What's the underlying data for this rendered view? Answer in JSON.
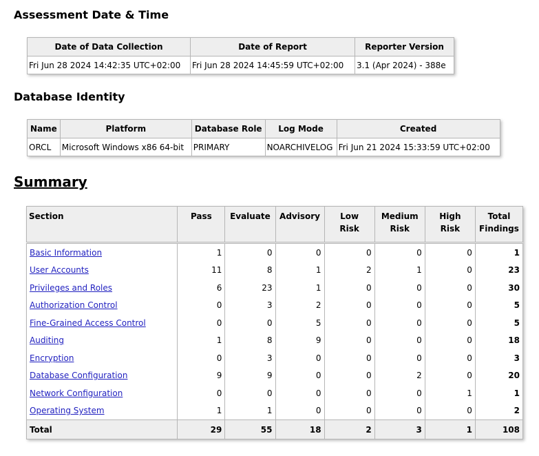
{
  "sections": {
    "assessment_title": "Assessment Date & Time",
    "identity_title": "Database Identity",
    "summary_title": "Summary"
  },
  "assessment": {
    "headers": [
      "Date of Data Collection",
      "Date of Report",
      "Reporter Version"
    ],
    "row": [
      "Fri Jun 28 2024 14:42:35 UTC+02:00",
      "Fri Jun 28 2024 14:45:59 UTC+02:00",
      "3.1 (Apr 2024) - 388e"
    ]
  },
  "identity": {
    "headers": [
      "Name",
      "Platform",
      "Database Role",
      "Log Mode",
      "Created"
    ],
    "row": [
      "ORCL",
      "Microsoft Windows x86 64-bit",
      "PRIMARY",
      "NOARCHIVELOG",
      "Fri Jun 21 2024 15:33:59 UTC+02:00"
    ]
  },
  "summary": {
    "headers": {
      "section": "Section",
      "pass": "Pass",
      "evaluate": "Evaluate",
      "advisory": "Advisory",
      "low1": "Low",
      "low2": "Risk",
      "med1": "Medium",
      "med2": "Risk",
      "high1": "High",
      "high2": "Risk",
      "total1": "Total",
      "total2": "Findings"
    },
    "rows": [
      {
        "section": "Basic Information",
        "pass": "1",
        "evaluate": "0",
        "advisory": "0",
        "low": "0",
        "medium": "0",
        "high": "0",
        "total": "1"
      },
      {
        "section": "User Accounts",
        "pass": "11",
        "evaluate": "8",
        "advisory": "1",
        "low": "2",
        "medium": "1",
        "high": "0",
        "total": "23"
      },
      {
        "section": "Privileges and Roles",
        "pass": "6",
        "evaluate": "23",
        "advisory": "1",
        "low": "0",
        "medium": "0",
        "high": "0",
        "total": "30"
      },
      {
        "section": "Authorization Control",
        "pass": "0",
        "evaluate": "3",
        "advisory": "2",
        "low": "0",
        "medium": "0",
        "high": "0",
        "total": "5"
      },
      {
        "section": "Fine-Grained Access Control",
        "pass": "0",
        "evaluate": "0",
        "advisory": "5",
        "low": "0",
        "medium": "0",
        "high": "0",
        "total": "5"
      },
      {
        "section": "Auditing",
        "pass": "1",
        "evaluate": "8",
        "advisory": "9",
        "low": "0",
        "medium": "0",
        "high": "0",
        "total": "18"
      },
      {
        "section": "Encryption",
        "pass": "0",
        "evaluate": "3",
        "advisory": "0",
        "low": "0",
        "medium": "0",
        "high": "0",
        "total": "3"
      },
      {
        "section": "Database Configuration",
        "pass": "9",
        "evaluate": "9",
        "advisory": "0",
        "low": "0",
        "medium": "2",
        "high": "0",
        "total": "20"
      },
      {
        "section": "Network Configuration",
        "pass": "0",
        "evaluate": "0",
        "advisory": "0",
        "low": "0",
        "medium": "0",
        "high": "1",
        "total": "1"
      },
      {
        "section": "Operating System",
        "pass": "1",
        "evaluate": "1",
        "advisory": "0",
        "low": "0",
        "medium": "0",
        "high": "0",
        "total": "2"
      }
    ],
    "total": {
      "label": "Total",
      "pass": "29",
      "evaluate": "55",
      "advisory": "18",
      "low": "2",
      "medium": "3",
      "high": "1",
      "total": "108"
    }
  },
  "colors": {
    "link": "#1f1fbf",
    "header_bg": "#eeeeee",
    "border": "#b5b5b5"
  }
}
